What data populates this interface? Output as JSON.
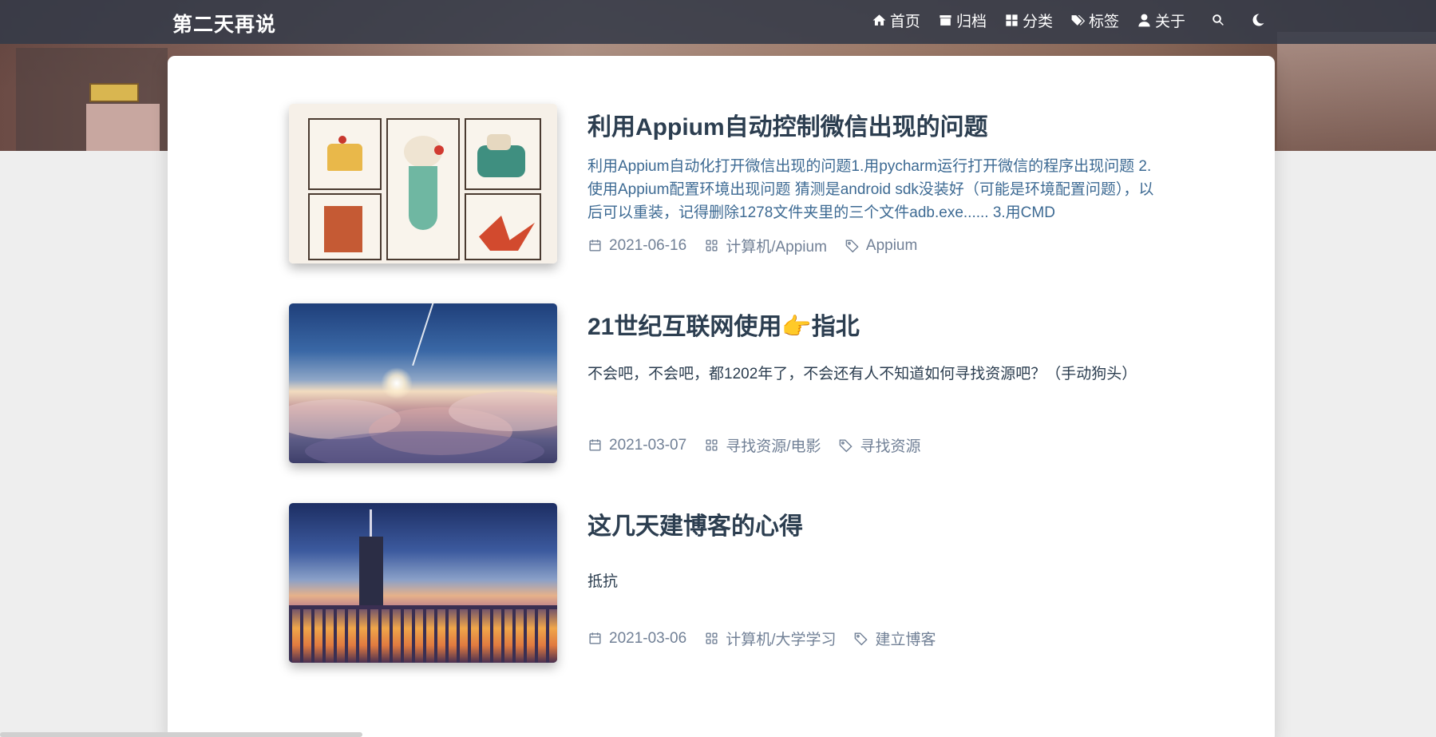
{
  "navbar": {
    "brand": "第二天再说",
    "items": [
      {
        "label": "首页",
        "icon": "home-icon"
      },
      {
        "label": "归档",
        "icon": "archive-icon"
      },
      {
        "label": "分类",
        "icon": "category-icon"
      },
      {
        "label": "标签",
        "icon": "tags-icon"
      },
      {
        "label": "关于",
        "icon": "user-icon"
      }
    ],
    "search_icon": "search-icon",
    "theme_icon": "moon-icon"
  },
  "posts": [
    {
      "title": "利用Appium自动控制微信出现的问题",
      "excerpt": "利用Appium自动化打开微信出现的问题1.用pycharm运行打开微信的程序出现问题 2.使用Appium配置环境出现问题 猜测是android sdk没装好（可能是环境配置问题），以后可以重装，记得删除1278文件夹里的三个文件adb.exe...... 3.用CMD",
      "date": "2021-06-16",
      "category": "计算机/Appium",
      "tag": "Appium"
    },
    {
      "title": "21世纪互联网使用👉指北",
      "excerpt": "不会吧，不会吧，都1202年了，不会还有人不知道如何寻找资源吧？（手动狗头）",
      "date": "2021-03-07",
      "category": "寻找资源/电影",
      "tag": "寻找资源"
    },
    {
      "title": "这几天建博客的心得",
      "excerpt": "抵抗",
      "date": "2021-03-06",
      "category": "计算机/大学学习",
      "tag": "建立博客"
    }
  ]
}
